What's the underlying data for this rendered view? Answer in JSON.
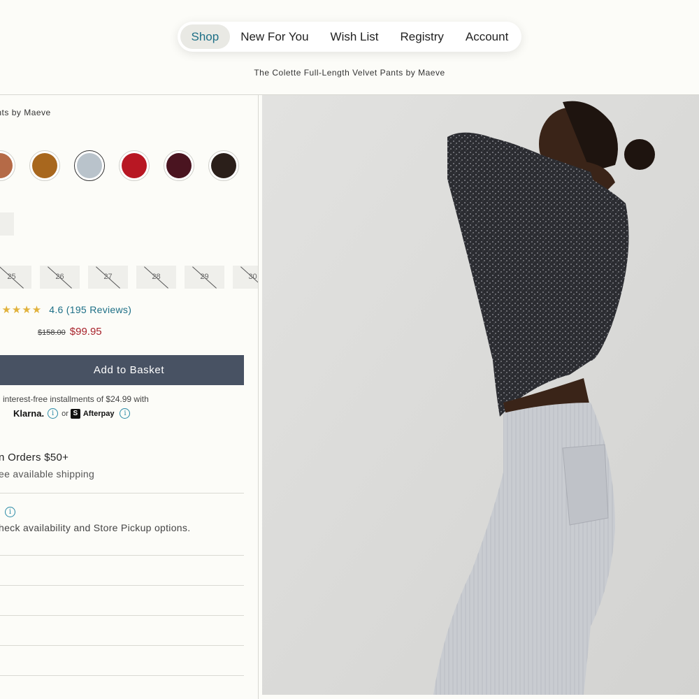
{
  "nav": {
    "items": [
      {
        "label": "Shop",
        "active": true
      },
      {
        "label": "New For You",
        "active": false
      },
      {
        "label": "Wish List",
        "active": false
      },
      {
        "label": "Registry",
        "active": false
      },
      {
        "label": "Account",
        "active": false
      }
    ],
    "accent": "#1d6f86"
  },
  "page_subtitle": "The Colette Full-Length Velvet Pants by Maeve",
  "breadcrumb_partial": "elvet Pants by Maeve",
  "swatches": [
    {
      "color": "#b56a47",
      "selected": false
    },
    {
      "color": "#a8671e",
      "selected": false
    },
    {
      "color": "#b9c3cb",
      "selected": true
    },
    {
      "color": "#b81723",
      "selected": false
    },
    {
      "color": "#4a1420",
      "selected": false
    },
    {
      "color": "#2b1f1a",
      "selected": false
    }
  ],
  "sizes": [
    {
      "label": "25",
      "available": false
    },
    {
      "label": "26",
      "available": false
    },
    {
      "label": "27",
      "available": false
    },
    {
      "label": "28",
      "available": false
    },
    {
      "label": "29",
      "available": false
    },
    {
      "label": "30",
      "available": false
    }
  ],
  "rating": {
    "stars": "★★★★★",
    "text": "4.6 (195 Reviews)",
    "value": 4.6
  },
  "price": {
    "original": "$158.00",
    "sale": "$99.95",
    "sale_color": "#a8232c"
  },
  "basket": {
    "label": "Add to Basket",
    "color": "#485263"
  },
  "installments": {
    "text": "interest-free installments of $24.99 with",
    "klarna": "Klarna.",
    "or": "or",
    "afterpay": "Afterpay"
  },
  "shipping": {
    "title": "n Orders $50+",
    "subtitle": "ee available shipping"
  },
  "store": {
    "text": "heck availability and Store Pickup options."
  },
  "image": {
    "description_icon": "product-photo"
  }
}
